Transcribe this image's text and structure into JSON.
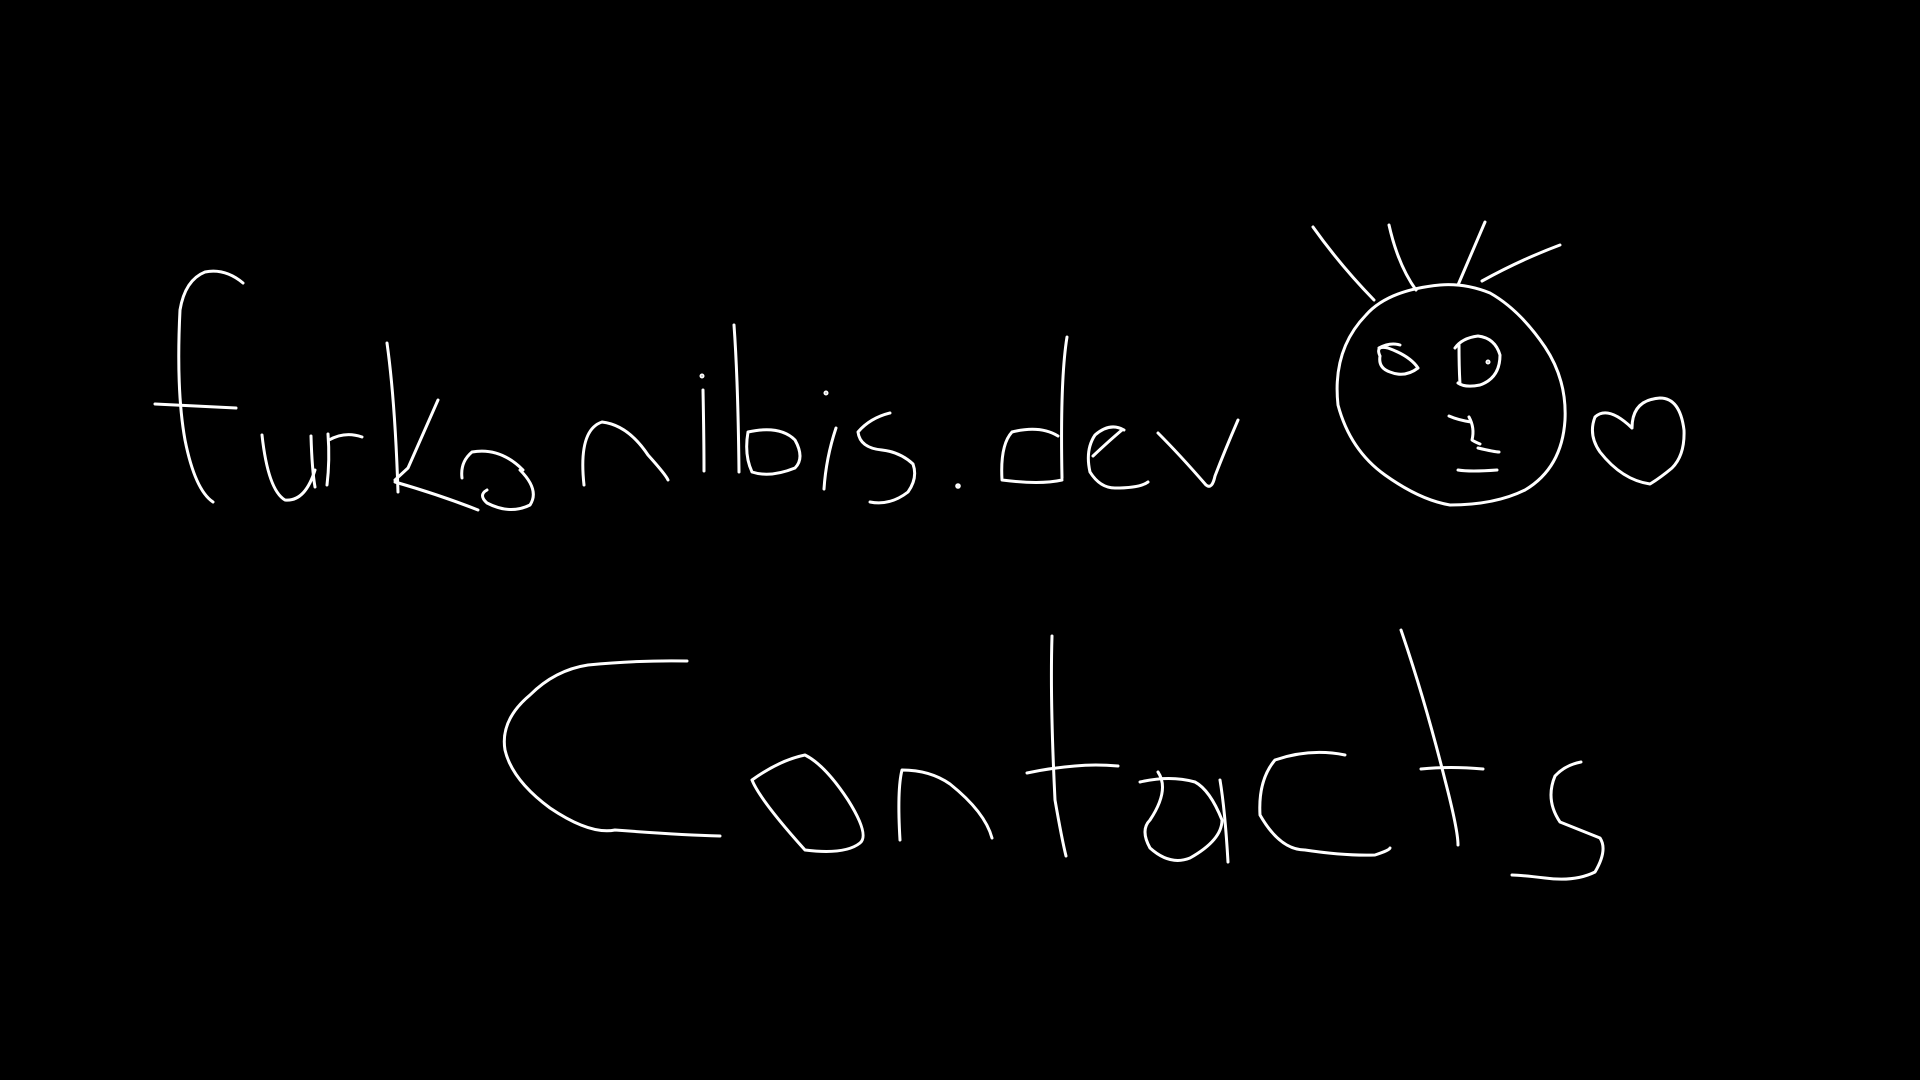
{
  "page": {
    "background_color": "#000000",
    "stroke_color": "#ffffff"
  },
  "header": {
    "site_name": "furkanibis.dev"
  },
  "main": {
    "heading": "Contacts"
  },
  "icons": {
    "avatar": "doodle-face-icon",
    "heart": "heart-icon"
  }
}
